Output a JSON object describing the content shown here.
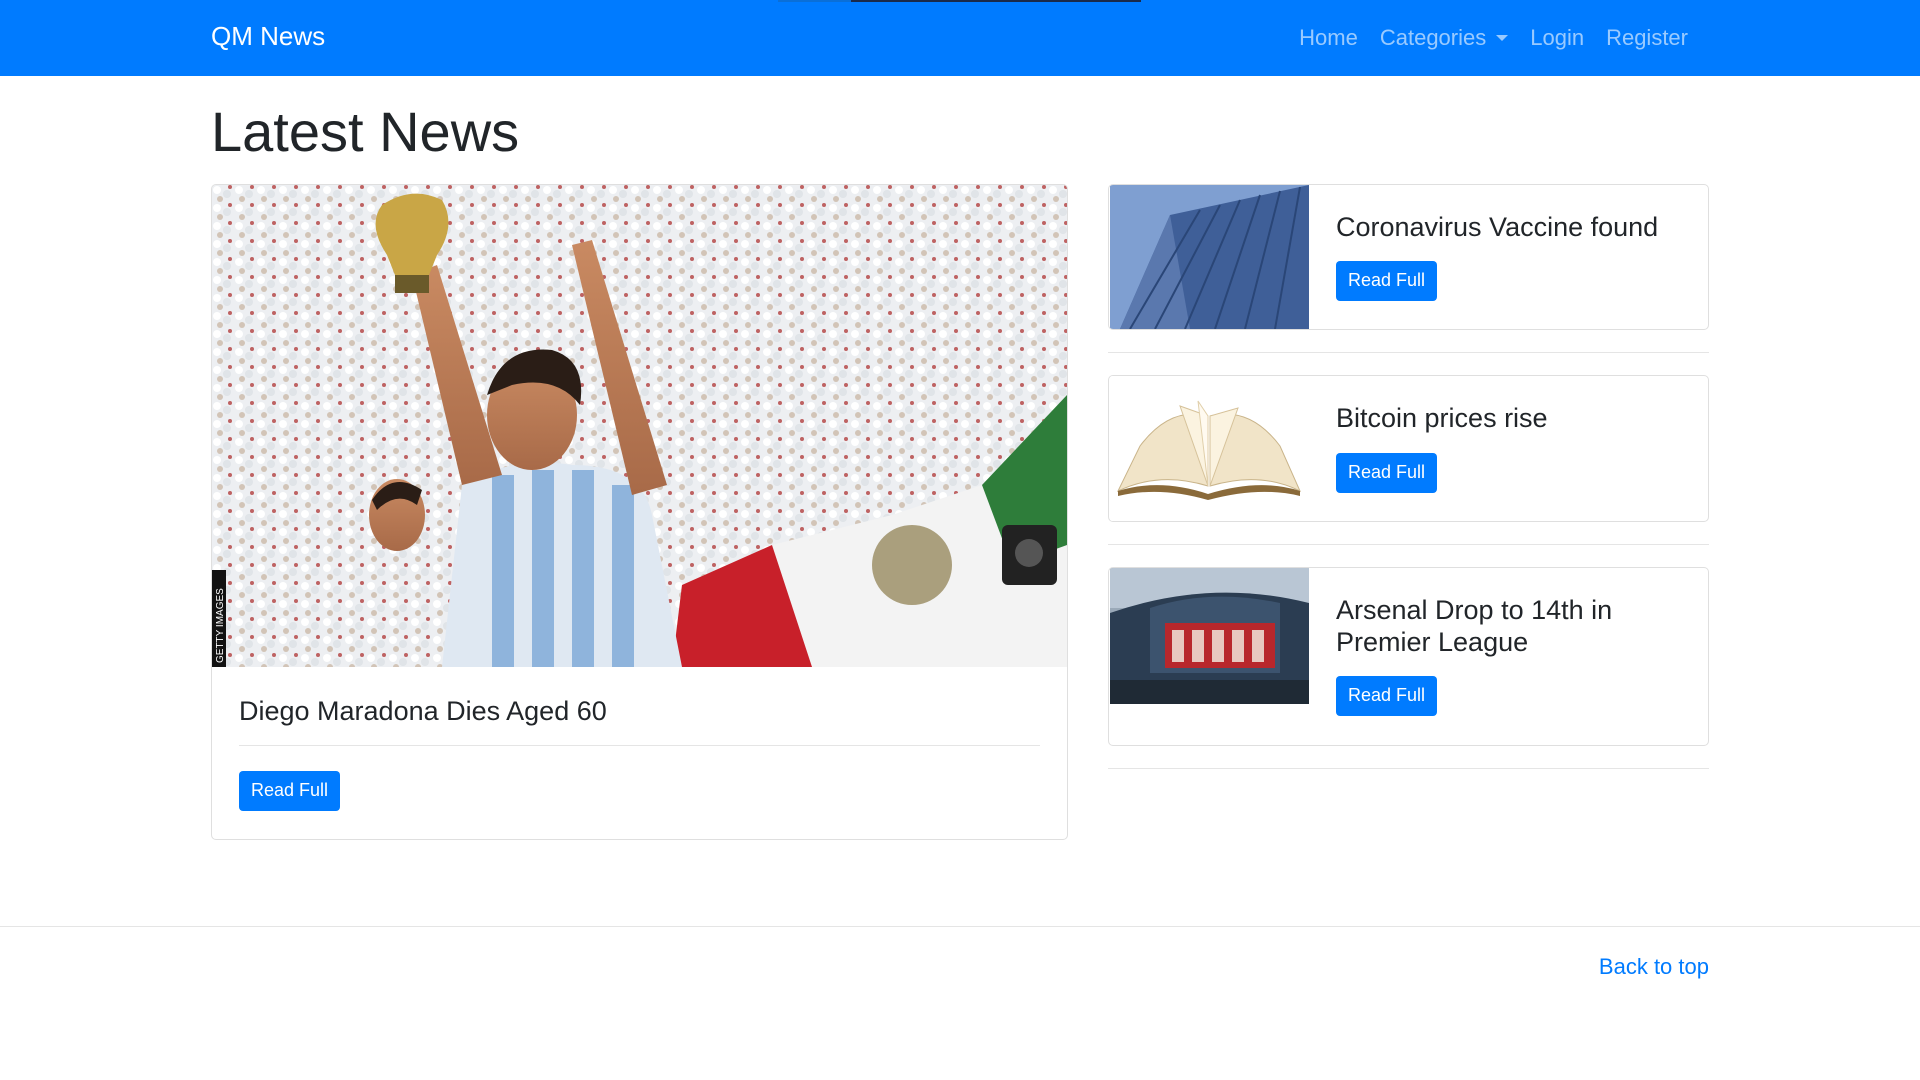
{
  "nav": {
    "brand": "QM News",
    "links": [
      {
        "label": "Home"
      },
      {
        "label": "Categories"
      },
      {
        "label": "Login"
      },
      {
        "label": "Register"
      }
    ]
  },
  "page": {
    "title": "Latest News"
  },
  "featured": {
    "title": "Diego Maradona Dies Aged 60",
    "button_label": "Read Full",
    "image_credit": "GETTY IMAGES"
  },
  "articles": [
    {
      "title": "Coronavirus Vaccine found",
      "button_label": "Read Full",
      "image": "building-image"
    },
    {
      "title": "Bitcoin prices rise",
      "button_label": "Read Full",
      "image": "open-book-image"
    },
    {
      "title": "Arsenal Drop to 14th in Premier League",
      "button_label": "Read Full",
      "image": "stadium-image"
    }
  ],
  "footer": {
    "back_to_top": "Back to top"
  },
  "colors": {
    "primary": "#007bff",
    "text": "#212529"
  }
}
